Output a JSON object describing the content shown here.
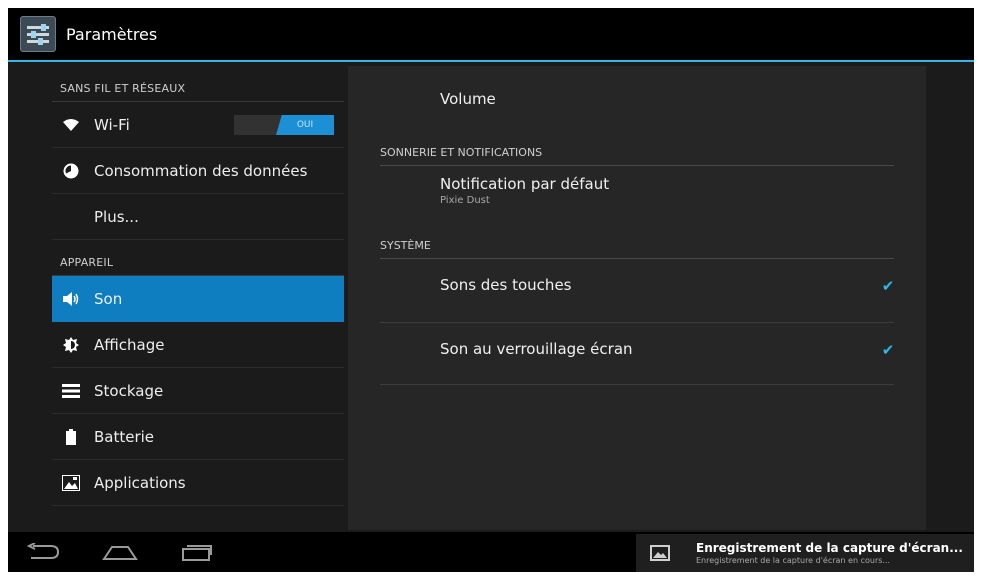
{
  "app": {
    "title": "Paramètres"
  },
  "sidebar": {
    "sections": [
      {
        "label": "SANS FIL ET RÉSEAUX"
      },
      {
        "label": "APPAREIL"
      }
    ],
    "wireless_items": [
      {
        "label": "Wi-Fi",
        "icon": "wifi-icon"
      },
      {
        "label": "Consommation des données",
        "icon": "data-usage-icon"
      },
      {
        "label": "Plus..."
      }
    ],
    "wifi_toggle": "OUI",
    "device_items": [
      {
        "label": "Son",
        "icon": "speaker-icon",
        "selected": true
      },
      {
        "label": "Affichage",
        "icon": "brightness-icon"
      },
      {
        "label": "Stockage",
        "icon": "storage-icon"
      },
      {
        "label": "Batterie",
        "icon": "battery-icon"
      },
      {
        "label": "Applications",
        "icon": "apps-icon"
      }
    ]
  },
  "content": {
    "volume": "Volume",
    "ringtone_section": "SONNERIE ET NOTIFICATIONS",
    "default_notification": {
      "title": "Notification par défaut",
      "value": "Pixie Dust"
    },
    "system_section": "SYSTÈME",
    "touch_sounds": {
      "label": "Sons des touches",
      "checked": true
    },
    "lock_sound": {
      "label": "Son au verrouillage écran",
      "checked": true
    }
  },
  "notification": {
    "title": "Enregistrement de la capture d'écran...",
    "subtitle": "Enregistrement de la capture d'écran en cours..."
  },
  "colors": {
    "accent": "#33b5e5",
    "selected": "#0e7ec0"
  }
}
